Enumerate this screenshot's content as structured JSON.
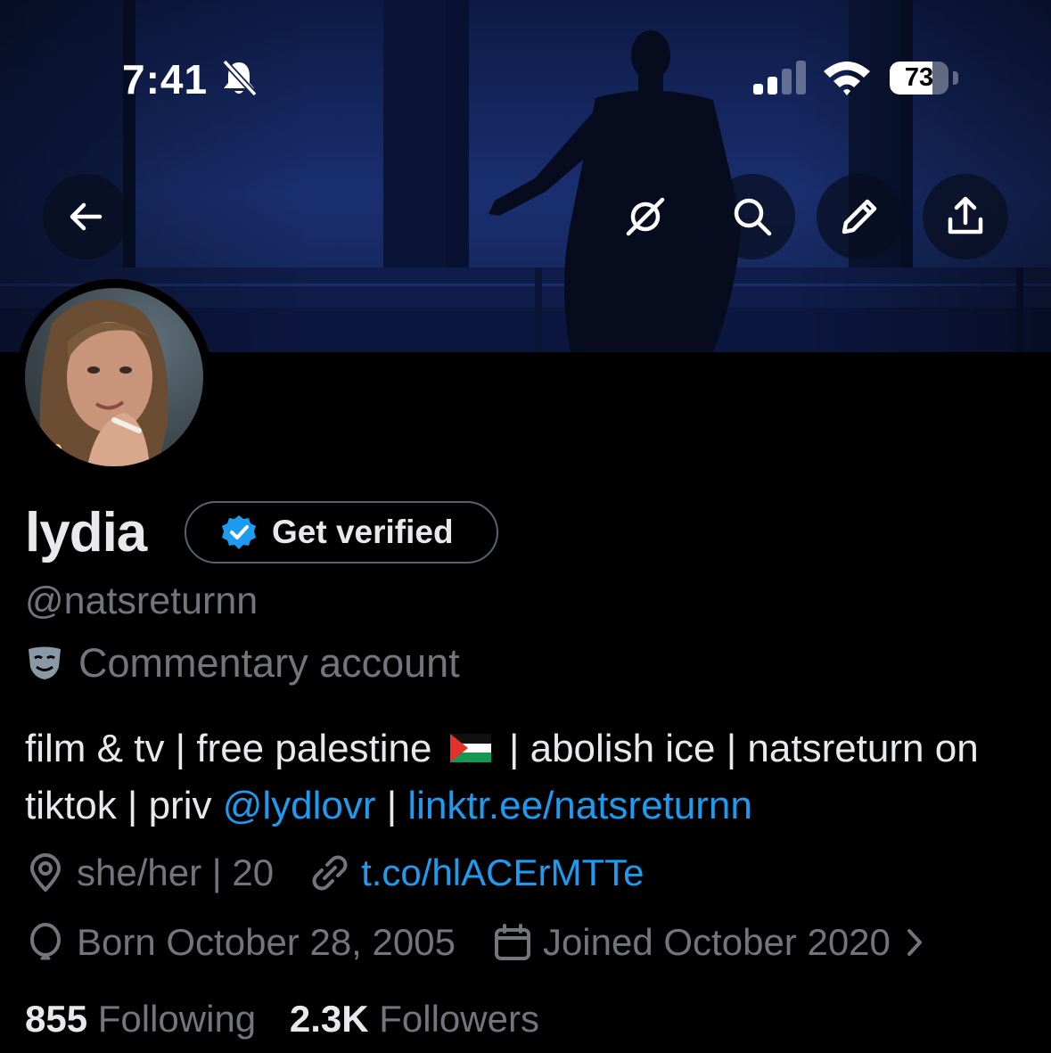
{
  "status_bar": {
    "time": "7:41",
    "battery_percent": "73",
    "battery_level": 0.73,
    "icons": [
      "bell-slash-icon",
      "cellular-signal-icon",
      "wifi-icon",
      "battery-icon"
    ]
  },
  "nav": {
    "back_icon": "arrow-left-icon",
    "actions": [
      "grok-icon",
      "search-icon",
      "pencil-icon",
      "share-icon"
    ]
  },
  "profile": {
    "name": "lydia",
    "get_verified_label": "Get verified",
    "handle": "@natsreturnn",
    "category_icon": "theater-mask-icon",
    "category": "Commentary account",
    "bio": {
      "part1": "film & tv | free palestine ",
      "flag_icon": "palestine-flag-icon",
      "part2": " | abolish ice | natsreturn on tiktok | priv ",
      "mention": "@lydlovr",
      "separator": " | ",
      "bio_link": "linktr.ee/natsreturnn"
    },
    "location_icon": "location-pin-icon",
    "location": "she/her | 20",
    "website_icon": "link-icon",
    "website": "t.co/hlACErMTTe",
    "birthday_icon": "balloon-icon",
    "birthday": "Born October 28, 2005",
    "joined_icon": "calendar-icon",
    "joined": "Joined October 2020",
    "following_count": "855",
    "following_label": "Following",
    "followers_count": "2.3K",
    "followers_label": "Followers"
  },
  "colors": {
    "background": "#000000",
    "primary_text": "#e7e9ea",
    "secondary_text": "#71767b",
    "link": "#1d9bf0",
    "verified_badge": "#1d9bf0"
  }
}
